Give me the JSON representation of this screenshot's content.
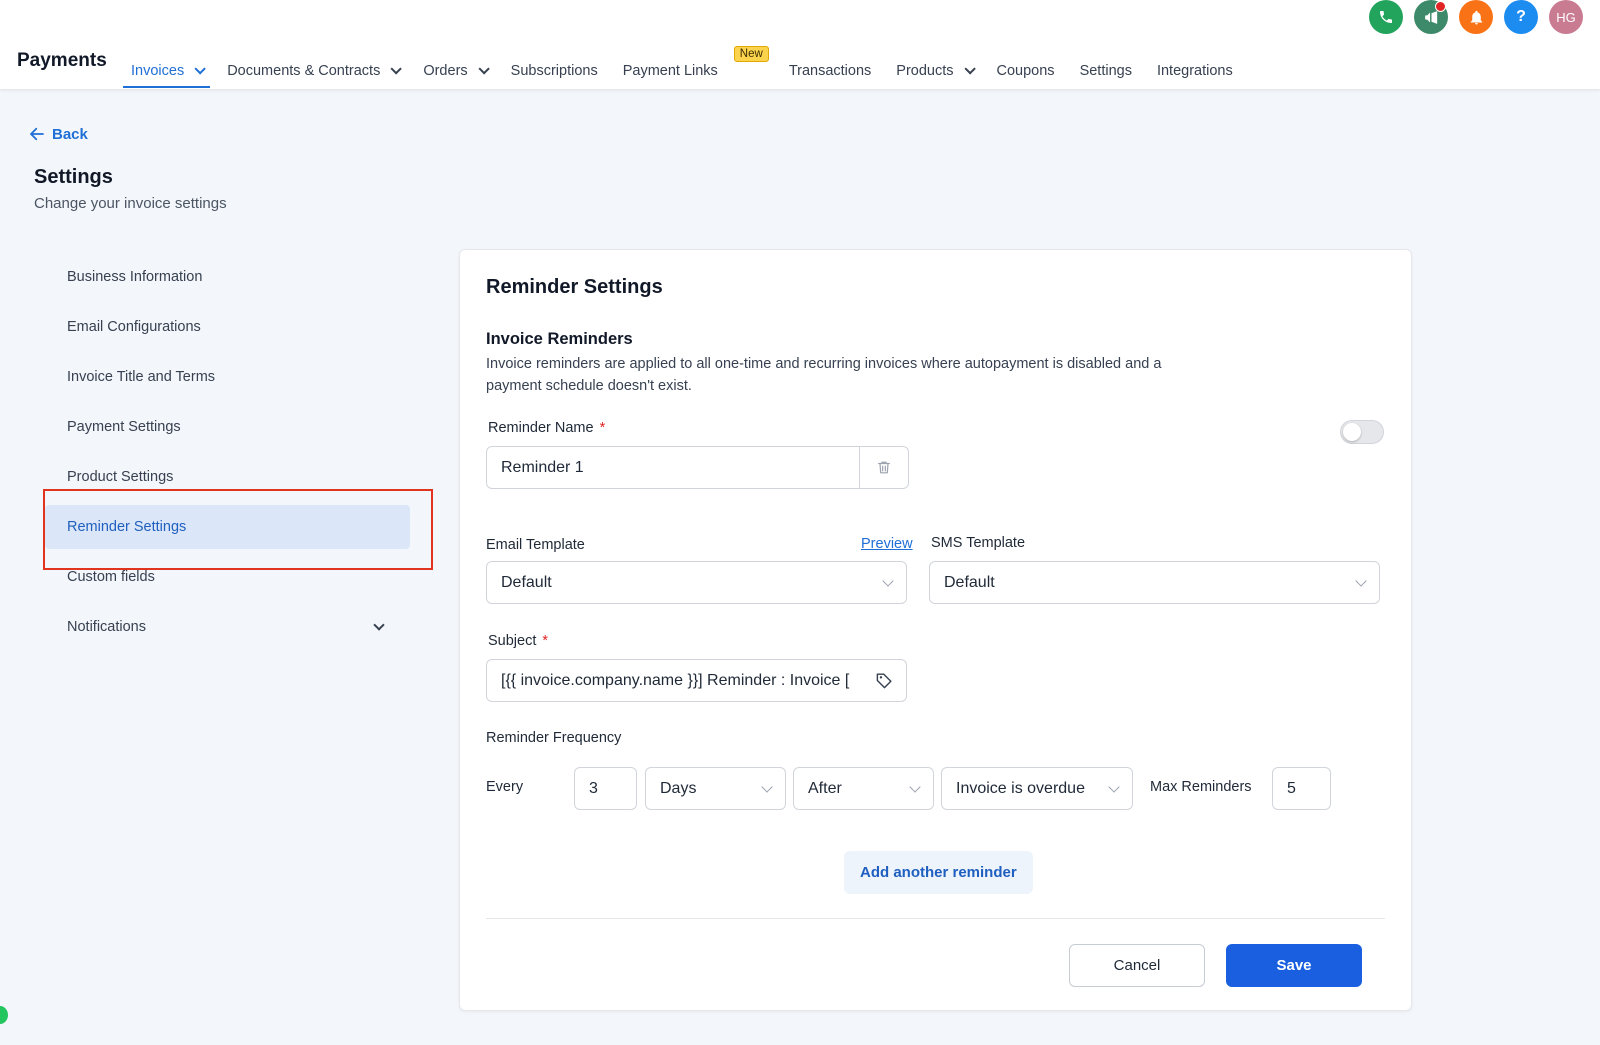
{
  "header": {
    "brand": "Payments",
    "nav": [
      {
        "label": "Invoices",
        "dropdown": true,
        "active": true
      },
      {
        "label": "Documents & Contracts",
        "dropdown": true
      },
      {
        "label": "Orders",
        "dropdown": true
      },
      {
        "label": "Subscriptions"
      },
      {
        "label": "Payment Links",
        "badge": "New"
      },
      {
        "label": "Transactions"
      },
      {
        "label": "Products",
        "dropdown": true
      },
      {
        "label": "Coupons"
      },
      {
        "label": "Settings"
      },
      {
        "label": "Integrations"
      }
    ],
    "icons": [
      {
        "name": "phone-icon",
        "color": "#22a45d"
      },
      {
        "name": "megaphone-icon",
        "color": "#3d8a6a"
      },
      {
        "name": "bell-icon",
        "color": "#f97316"
      },
      {
        "name": "help-icon",
        "color": "#1d8cf0",
        "glyph": "?"
      },
      {
        "name": "avatar",
        "color": "#c97b92",
        "glyph": "HG"
      }
    ]
  },
  "page": {
    "back_label": "Back",
    "title": "Settings",
    "subtitle": "Change your invoice settings"
  },
  "sidebar": {
    "items": [
      {
        "label": "Business Information"
      },
      {
        "label": "Email Configurations"
      },
      {
        "label": "Invoice Title and Terms"
      },
      {
        "label": "Payment Settings"
      },
      {
        "label": "Product Settings"
      },
      {
        "label": "Reminder Settings",
        "active": true
      },
      {
        "label": "Custom fields"
      },
      {
        "label": "Notifications",
        "expandable": true
      }
    ]
  },
  "card": {
    "title": "Reminder Settings",
    "section_title": "Invoice Reminders",
    "section_desc": "Invoice reminders are applied to all one-time and recurring invoices where autopayment is disabled and a payment schedule doesn't exist.",
    "reminder_name_label": "Reminder Name",
    "reminder_name_value": "Reminder 1",
    "toggle_on": false,
    "email_template_label": "Email Template",
    "preview_label": "Preview",
    "email_template_value": "Default",
    "sms_template_label": "SMS Template",
    "sms_template_value": "Default",
    "subject_label": "Subject",
    "subject_value": "[{{ invoice.company.name }}] Reminder : Invoice [",
    "frequency_label": "Reminder Frequency",
    "every_label": "Every",
    "every_value": "3",
    "unit_value": "Days",
    "when_value": "After",
    "trigger_value": "Invoice is overdue",
    "max_label": "Max Reminders",
    "max_value": "5",
    "add_label": "Add another reminder",
    "cancel_label": "Cancel",
    "save_label": "Save",
    "required_mark": "*"
  }
}
